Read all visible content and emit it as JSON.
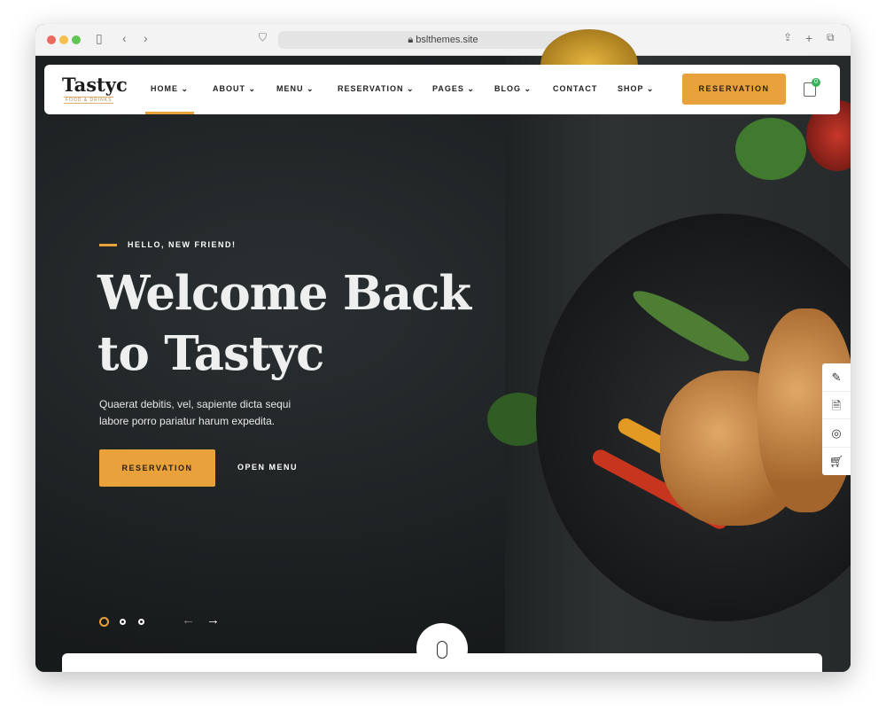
{
  "browser": {
    "url": "bslthemes.site"
  },
  "nav": {
    "logo": "Tastyc",
    "logo_sub": "FOOD & DRINKS",
    "items": [
      {
        "label": "HOME"
      },
      {
        "label": "ABOUT"
      },
      {
        "label": "MENU"
      },
      {
        "label": "RESERVATION"
      },
      {
        "label": "PAGES"
      },
      {
        "label": "BLOG"
      },
      {
        "label": "CONTACT"
      },
      {
        "label": "SHOP"
      }
    ],
    "cta": "RESERVATION",
    "cart_count": "0"
  },
  "hero": {
    "eyebrow": "HELLO, NEW FRIEND!",
    "title": "Welcome Back to Tastyc",
    "description": "Quaerat debitis, vel, sapiente dicta sequi labore porro pariatur harum expedita.",
    "primary_button": "RESERVATION",
    "secondary_button": "OPEN MENU",
    "slides": 3,
    "active_slide": 1
  },
  "side_panel": {
    "icons": [
      "edit-document-icon",
      "doc-file-icon",
      "lifebuoy-icon",
      "cart-icon"
    ]
  },
  "colors": {
    "accent": "#e9a23b",
    "dark": "#1a1d1e"
  }
}
